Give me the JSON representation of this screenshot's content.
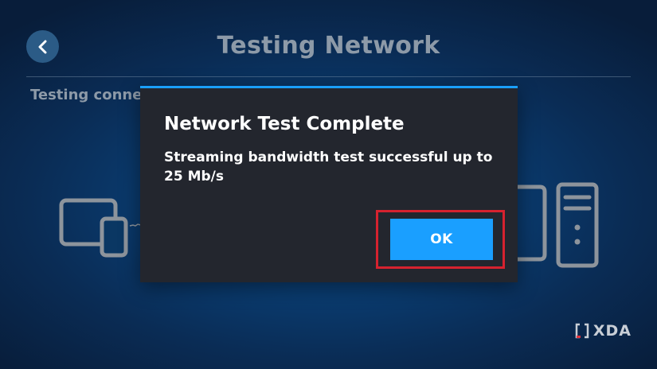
{
  "header": {
    "title": "Testing Network",
    "back_icon": "chevron-left-icon"
  },
  "status": {
    "text": "Testing connec"
  },
  "diagram": {
    "left_device_icon": "monitor-phone-icon",
    "right_device_icon": "monitor-tower-icon",
    "connection_icon": "connection-line-icon"
  },
  "dialog": {
    "title": "Network Test Complete",
    "message": "Streaming bandwidth test successful up to 25 Mb/s",
    "ok_label": "OK"
  },
  "watermark": {
    "text": "XDA",
    "icon": "xda-logo-icon"
  },
  "colors": {
    "accent": "#1a9fff",
    "dialog_bg": "#23262e",
    "highlight": "#d6222f",
    "muted_text": "#8d9aa8"
  }
}
